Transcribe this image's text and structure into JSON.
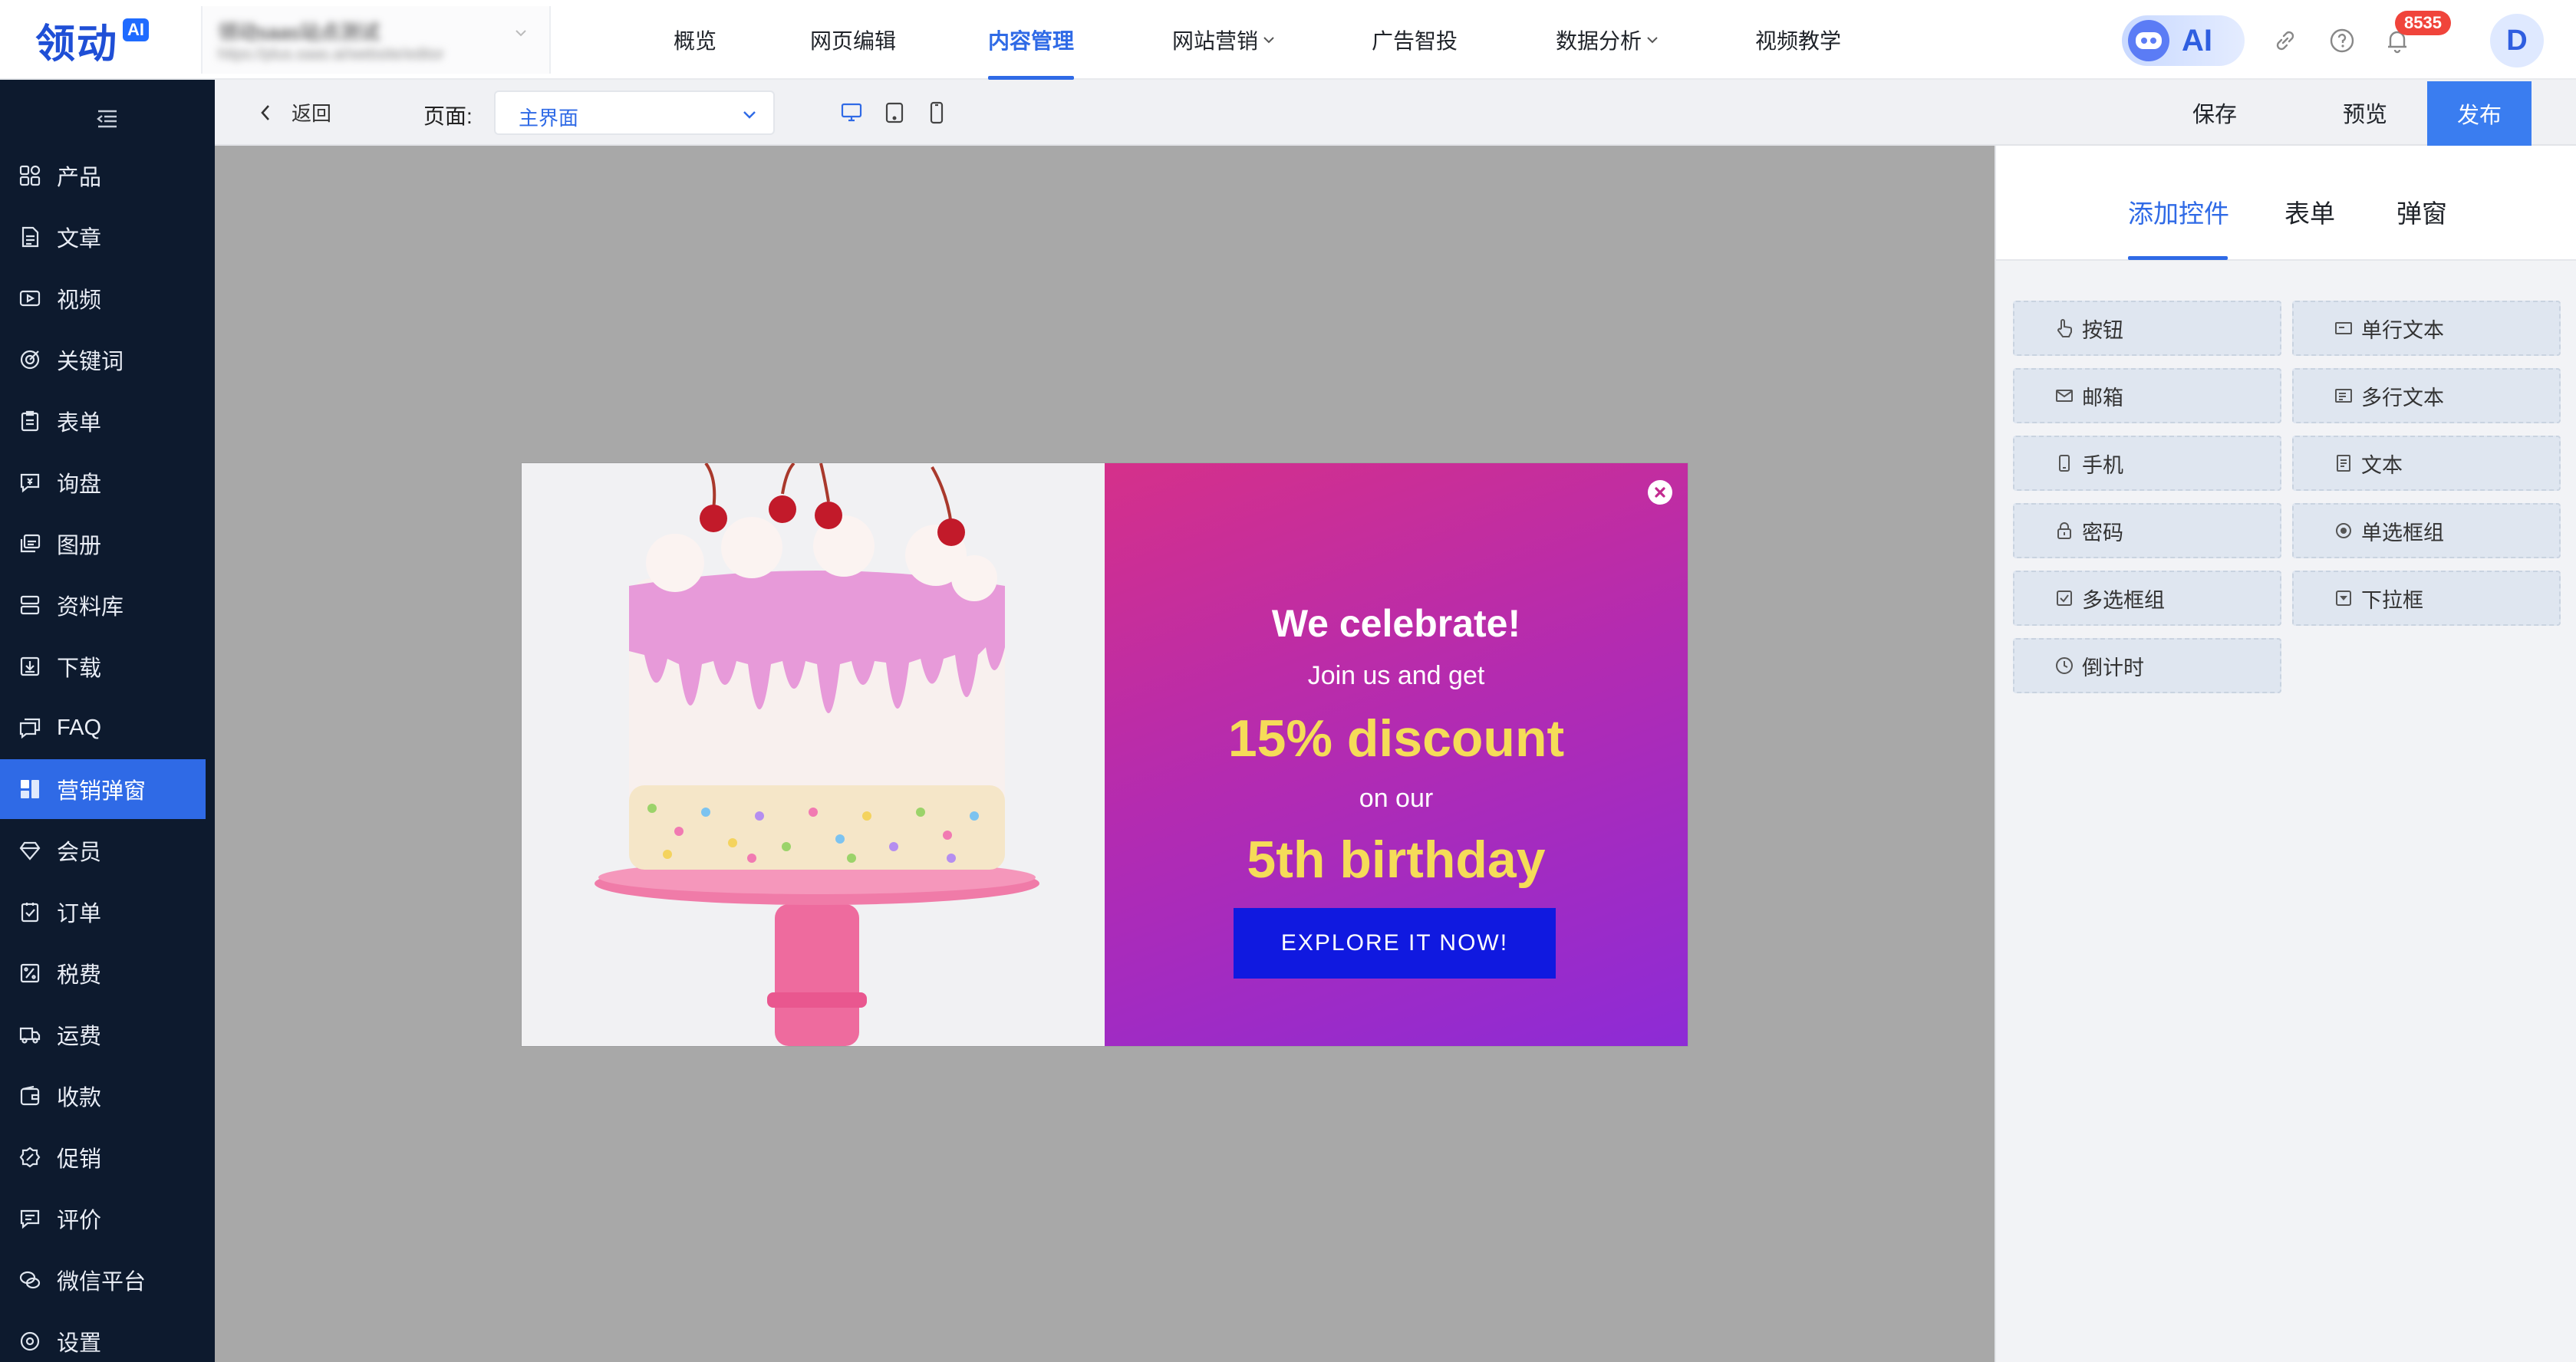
{
  "brand": {
    "logo_text": "领动",
    "logo_badge": "AI"
  },
  "site": {
    "name": "领动saas站点测试",
    "url": "https://plus.saas.ai/website/editor"
  },
  "top_nav": [
    {
      "label": "概览"
    },
    {
      "label": "网页编辑"
    },
    {
      "label": "内容管理",
      "active": true
    },
    {
      "label": "网站营销",
      "dropdown": true
    },
    {
      "label": "广告智投"
    },
    {
      "label": "数据分析",
      "dropdown": true
    },
    {
      "label": "视频教学"
    }
  ],
  "header_right": {
    "ai_label": "AI",
    "notification_count": "8535",
    "avatar_initial": "D"
  },
  "sidebar": {
    "items": [
      {
        "label": "产品",
        "icon": "grid-icon"
      },
      {
        "label": "文章",
        "icon": "document-icon"
      },
      {
        "label": "视频",
        "icon": "video-icon"
      },
      {
        "label": "关键词",
        "icon": "target-icon"
      },
      {
        "label": "表单",
        "icon": "clipboard-icon"
      },
      {
        "label": "询盘",
        "icon": "inquiry-icon"
      },
      {
        "label": "图册",
        "icon": "album-icon"
      },
      {
        "label": "资料库",
        "icon": "database-icon"
      },
      {
        "label": "下载",
        "icon": "download-icon"
      },
      {
        "label": "FAQ",
        "icon": "faq-icon"
      },
      {
        "label": "营销弹窗",
        "icon": "popup-icon",
        "active": true
      },
      {
        "label": "会员",
        "icon": "diamond-icon"
      },
      {
        "label": "订单",
        "icon": "order-icon"
      },
      {
        "label": "税费",
        "icon": "tax-icon"
      },
      {
        "label": "运费",
        "icon": "truck-icon"
      },
      {
        "label": "收款",
        "icon": "wallet-icon"
      },
      {
        "label": "促销",
        "icon": "promo-icon"
      },
      {
        "label": "评价",
        "icon": "comment-icon"
      },
      {
        "label": "微信平台",
        "icon": "wechat-icon"
      },
      {
        "label": "设置",
        "icon": "settings-icon"
      }
    ]
  },
  "toolbar": {
    "back_label": "返回",
    "page_label": "页面:",
    "page_value": "主界面",
    "save_label": "保存",
    "preview_label": "预览",
    "publish_label": "发布"
  },
  "popup": {
    "headline": "We celebrate!",
    "line1": "Join us and get",
    "highlight1": "15% discount",
    "line2": "on our",
    "highlight2": "5th birthday",
    "button": "EXPLORE IT NOW!",
    "colors": {
      "gradient_start": "#d5308a",
      "gradient_end": "#8d2bd6",
      "highlight": "#f5dc58",
      "button_bg": "#1019e0"
    }
  },
  "right_panel": {
    "tabs": [
      {
        "label": "添加控件",
        "active": true
      },
      {
        "label": "表单"
      },
      {
        "label": "弹窗"
      }
    ],
    "controls": [
      {
        "label": "按钮",
        "icon": "hand-pointer-icon"
      },
      {
        "label": "单行文本",
        "icon": "single-line-icon"
      },
      {
        "label": "邮箱",
        "icon": "mail-icon"
      },
      {
        "label": "多行文本",
        "icon": "multi-line-icon"
      },
      {
        "label": "手机",
        "icon": "phone-icon"
      },
      {
        "label": "文本",
        "icon": "text-icon"
      },
      {
        "label": "密码",
        "icon": "lock-icon"
      },
      {
        "label": "单选框组",
        "icon": "radio-icon"
      },
      {
        "label": "多选框组",
        "icon": "checkbox-icon"
      },
      {
        "label": "下拉框",
        "icon": "dropdown-icon"
      },
      {
        "label": "倒计时",
        "icon": "clock-icon"
      }
    ]
  },
  "colors": {
    "accent": "#2f6ae6",
    "sidebar_bg": "#0d1a2e",
    "canvas_bg": "#a8a8a8"
  }
}
